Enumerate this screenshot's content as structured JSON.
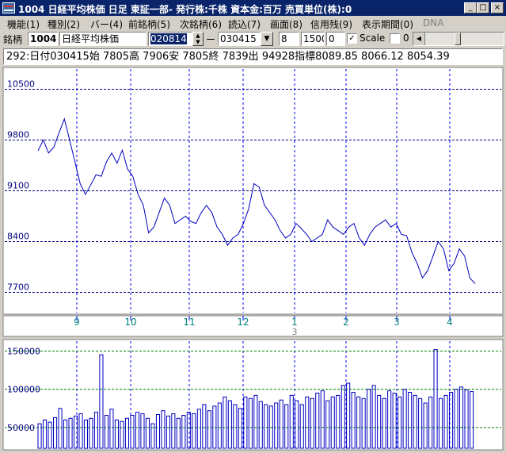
{
  "window": {
    "title": "1004 日経平均株価  日足  東証一部-  発行株:千株  資本金:百万  売買単位(株):0",
    "minimize": "_",
    "maximize": "□",
    "close": "×"
  },
  "menu": [
    {
      "label": "機能(1)"
    },
    {
      "label": "種別(2)"
    },
    {
      "label": "バー(4)"
    },
    {
      "label": "前銘柄(5)"
    },
    {
      "label": "次銘柄(6)"
    },
    {
      "label": "読込(7)"
    },
    {
      "label": "画面(8)"
    },
    {
      "label": "信用残(9)"
    },
    {
      "label": "表示期間(0)"
    },
    {
      "label": "DNA"
    }
  ],
  "toolbar": {
    "label_meigara": "銘柄",
    "code": "1004",
    "name": "日経平均株価",
    "date_from": "020814",
    "dash": "ー",
    "date_to": "030415",
    "field1": "8",
    "field2": "1500",
    "field3": "0",
    "scale_checked": "✓",
    "scale_label": "Scale",
    "field4": "0"
  },
  "info_line": "292:日付030415始 7805高 7906安 7805終 7839出 94928指標8089.85   8066.12   8054.39",
  "colors": {
    "price_line": "#0000c0",
    "volume_bar": "#0000c0",
    "grid_vertical": "#0000ff",
    "grid_volume": "#008000",
    "axis_label": "#000080",
    "month_label": "#008080"
  },
  "chart_data": [
    {
      "type": "line",
      "title": "",
      "ylim": [
        7400,
        10800
      ],
      "yticks": [
        10500,
        9800,
        9100,
        8400,
        7700
      ],
      "x_months": [
        "9",
        "10",
        "11",
        "12",
        "1",
        "2",
        "3",
        "4"
      ],
      "year_marker": "3",
      "series": [
        {
          "values": [
            9650,
            9800,
            9620,
            9700,
            9900,
            10090,
            9800,
            9500,
            9200,
            9050,
            9180,
            9320,
            9300,
            9500,
            9620,
            9480,
            9660,
            9400,
            9300,
            9050,
            8900,
            8520,
            8600,
            8800,
            9000,
            8900,
            8650,
            8700,
            8750,
            8680,
            8650,
            8800,
            8900,
            8800,
            8600,
            8500,
            8350,
            8450,
            8500,
            8650,
            8850,
            9200,
            9150,
            8900,
            8800,
            8700,
            8550,
            8450,
            8500,
            8650,
            8580,
            8500,
            8400,
            8450,
            8500,
            8700,
            8600,
            8550,
            8500,
            8600,
            8650,
            8450,
            8350,
            8500,
            8600,
            8650,
            8700,
            8600,
            8650,
            8500,
            8480,
            8250,
            8100,
            7900,
            8000,
            8200,
            8400,
            8300,
            8000,
            8100,
            8300,
            8200,
            7900,
            7820
          ]
        }
      ]
    },
    {
      "type": "bar",
      "title": "",
      "ylim": [
        25000,
        165000
      ],
      "yticks": [
        150000,
        100000,
        50000
      ],
      "series": [
        {
          "values": [
            55000,
            60000,
            57000,
            63000,
            75000,
            60000,
            62000,
            65000,
            68000,
            60000,
            62000,
            70000,
            145000,
            66000,
            74000,
            60000,
            58000,
            62000,
            66000,
            70000,
            68000,
            62000,
            55000,
            67000,
            72000,
            65000,
            68000,
            62000,
            66000,
            70000,
            68000,
            74000,
            80000,
            72000,
            78000,
            82000,
            90000,
            85000,
            80000,
            75000,
            90000,
            88000,
            92000,
            84000,
            80000,
            78000,
            82000,
            86000,
            80000,
            92000,
            85000,
            80000,
            90000,
            88000,
            95000,
            98000,
            85000,
            90000,
            92000,
            105000,
            108000,
            96000,
            90000,
            88000,
            100000,
            105000,
            92000,
            88000,
            98000,
            95000,
            90000,
            100000,
            96000,
            92000,
            88000,
            82000,
            90000,
            152000,
            88000,
            92000,
            96000,
            100000,
            103000,
            99000,
            97000
          ]
        }
      ]
    }
  ]
}
